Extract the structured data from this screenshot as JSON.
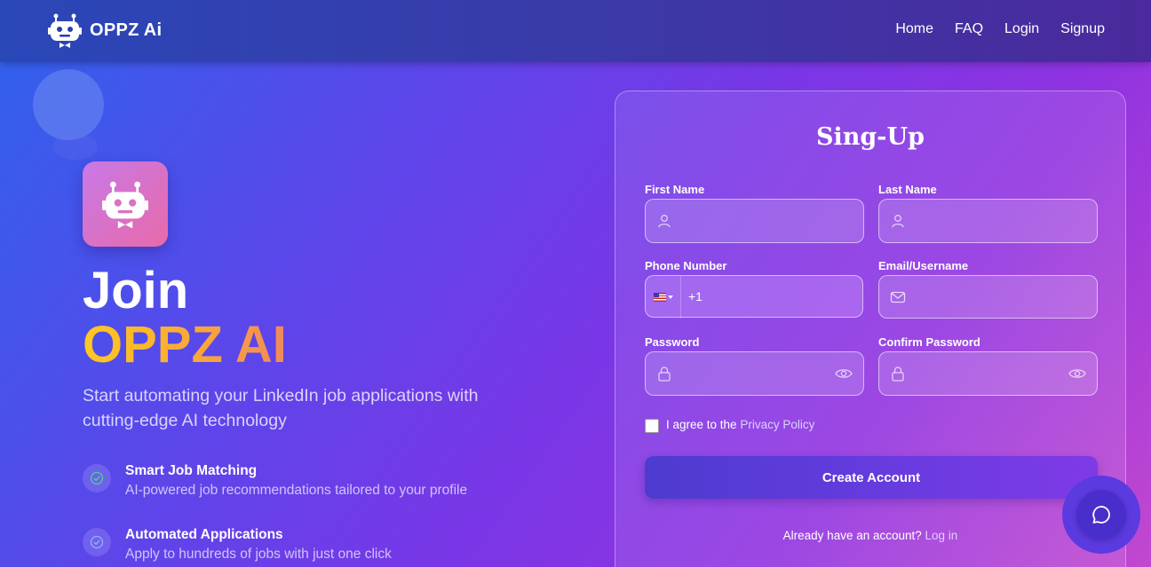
{
  "brand": {
    "name": "OPPZ Ai"
  },
  "nav": {
    "items": [
      "Home",
      "FAQ",
      "Login",
      "Signup"
    ]
  },
  "hero": {
    "title_line1": "Join",
    "title_line2": "OPPZ AI",
    "subtitle": "Start automating your LinkedIn job applications with cutting-edge AI technology",
    "features": [
      {
        "title": "Smart Job Matching",
        "description": "AI-powered job recommendations tailored to your profile",
        "icon": "check-circle-icon"
      },
      {
        "title": "Automated Applications",
        "description": "Apply to hundreds of jobs with just one click",
        "icon": "check-circle-icon"
      }
    ]
  },
  "form": {
    "title": "Sing-Up",
    "first_name": {
      "label": "First Name",
      "value": ""
    },
    "last_name": {
      "label": "Last Name",
      "value": ""
    },
    "phone": {
      "label": "Phone Number",
      "country_flag": "us-flag",
      "dial_code": "+1",
      "value": ""
    },
    "email": {
      "label": "Email/Username",
      "value": ""
    },
    "password": {
      "label": "Password",
      "value": ""
    },
    "confirm_password": {
      "label": "Confirm Password",
      "value": ""
    },
    "agree_text": "I agree to the",
    "privacy_link": "Privacy Policy",
    "submit_label": "Create Account",
    "already_text": "Already have an account?",
    "login_link": "Log in"
  },
  "colors": {
    "accent_yellow": "#ffc81f",
    "button": "#5a3bd8",
    "nav_bg": "#2f3fb0"
  }
}
